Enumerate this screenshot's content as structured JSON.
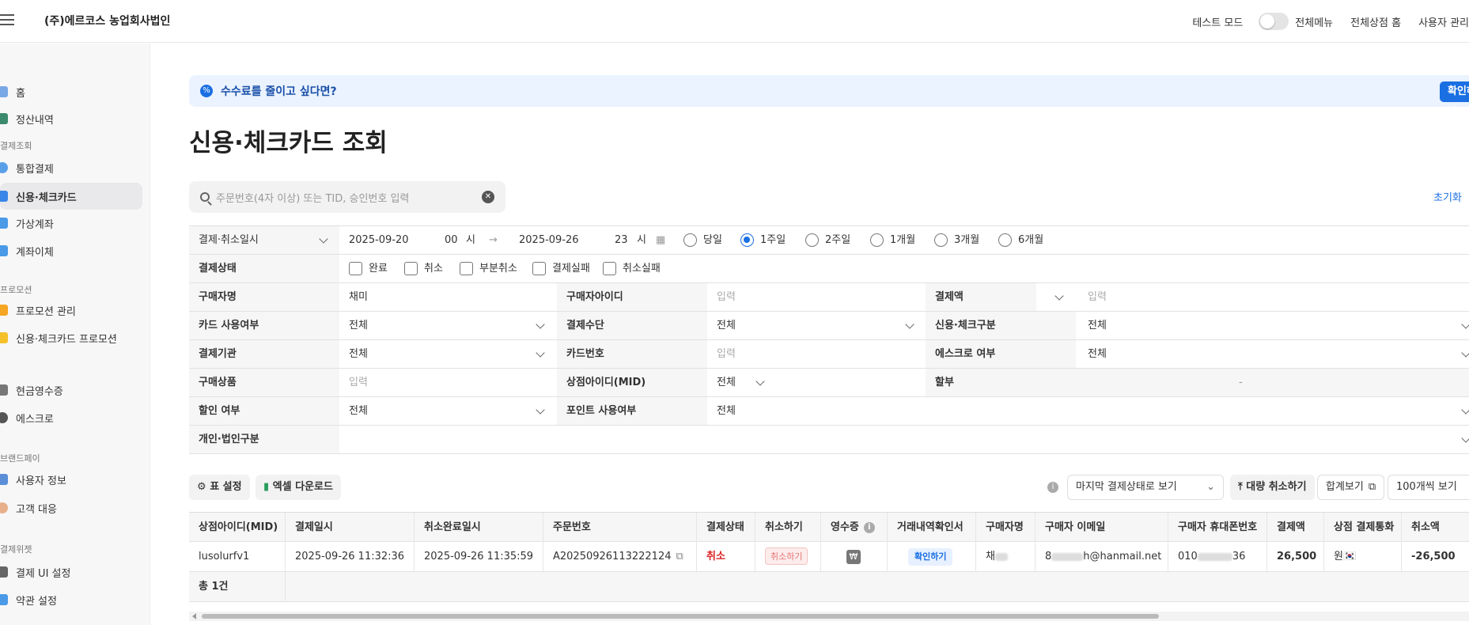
{
  "header": {
    "company": "(주)에르코스 농업회사법인",
    "test_mode": "테스트 모드",
    "all_menu": "전체메뉴",
    "all_store_home": "전체상점 홈",
    "user_manage": "사용자 관리"
  },
  "sidebar": {
    "home": "홈",
    "settlement": "정산내역",
    "sec_payment": "결제조회",
    "integrated": "통합결제",
    "card": "신용·체크카드",
    "virtual": "가상계좌",
    "transfer": "계좌이체",
    "sec_promo": "프로모션",
    "promo_manage": "프로모션 관리",
    "card_promo": "신용·체크카드 프로모션",
    "cash_receipt": "현금영수증",
    "escrow": "에스크로",
    "sec_brandpay": "브랜드페이",
    "user_info": "사용자 정보",
    "customer": "고객 대응",
    "sec_widget": "결제위젯",
    "ui_setting": "결제 UI 설정",
    "terms": "약관 설정"
  },
  "banner": {
    "icon": "%",
    "text": "수수료를 줄이고 싶다면?",
    "button": "확인하기",
    "close": "✕"
  },
  "page_title": "신용·체크카드 조회",
  "search": {
    "placeholder": "주문번호(4자 이상) 또는 TID, 승인번호 입력"
  },
  "reset": "초기화",
  "filters": {
    "date_type": "결제·취소일시",
    "start_date": "2025-09-20",
    "start_hour": "00",
    "hour_unit": "시",
    "arrow": "→",
    "end_date": "2025-09-26",
    "end_hour": "23",
    "ranges": [
      "당일",
      "1주일",
      "2주일",
      "1개월",
      "3개월",
      "6개월"
    ],
    "status_label": "결제상태",
    "statuses": [
      "완료",
      "취소",
      "부분취소",
      "결제실패",
      "취소실패"
    ],
    "buyer_name_label": "구매자명",
    "buyer_name_value": "채미",
    "buyer_id_label": "구매자아이디",
    "input_ph": "입력",
    "amount_label": "결제액",
    "card_use_label": "카드 사용여부",
    "all": "전체",
    "method_label": "결제수단",
    "credit_check_label": "신용·체크구분",
    "institution_label": "결제기관",
    "card_no_label": "카드번호",
    "escrow_label": "에스크로 여부",
    "product_label": "구매상품",
    "mid_label": "상점아이디(MID)",
    "installment_label": "할부",
    "installment_dash": "-",
    "discount_label": "할인 여부",
    "point_label": "포인트 사용여부",
    "personal_label": "개인·법인구분"
  },
  "toolbar": {
    "table_setting": "표 설정",
    "excel": "엑셀 다운로드",
    "last_status": "마지막 결제상태로 보기",
    "bulk_cancel": "대량 취소하기",
    "sum_view": "합계보기",
    "per_page": "100개씩 보기"
  },
  "table": {
    "headers": [
      "상점아이디(MID)",
      "결제일시",
      "취소완료일시",
      "주문번호",
      "결제상태",
      "취소하기",
      "영수증",
      "거래내역확인서",
      "구매자명",
      "구매자 이메일",
      "구매자 휴대폰번호",
      "결제액",
      "상점 결제통화",
      "취소액"
    ],
    "row": {
      "mid": "lusolurfv1",
      "paid_at": "2025-09-26 11:32:36",
      "cancelled_at": "2025-09-26 11:35:59",
      "order_no": "A20250926113222124",
      "status": "취소",
      "cancel_btn": "취소하기",
      "receipt_icon": "₩",
      "confirm_btn": "확인하기",
      "buyer": "채",
      "email_prefix": "8",
      "email_suffix": "h@hanmail.net",
      "phone_prefix": "010",
      "phone_suffix": "36",
      "amount": "26,500",
      "currency": "원🇰🇷",
      "cancel_amount": "-26,500"
    },
    "total": "총 1건"
  },
  "colors": {
    "accent": "#1a6fe3",
    "cancel": "#dd2222"
  }
}
